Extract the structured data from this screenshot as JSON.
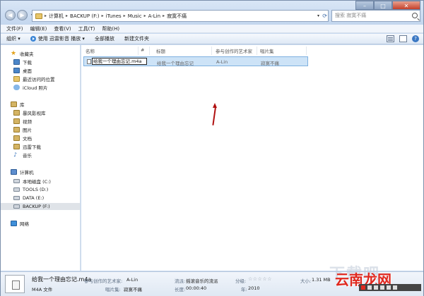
{
  "window": {
    "breadcrumbs": [
      "计算机",
      "BACKUP (F:)",
      "iTunes",
      "Music",
      "A-Lin",
      "寂寞不痛"
    ],
    "search_placeholder": "搜索 寂寞不痛",
    "controls": [
      "–",
      "□",
      "✕"
    ]
  },
  "menu": [
    "文件(F)",
    "编辑(E)",
    "查看(V)",
    "工具(T)",
    "帮助(H)"
  ],
  "toolbar": {
    "organize": "组织 ▾",
    "play_with": "使用 迅雷影音 播放 ▾",
    "play_all": "全部播放",
    "new_folder": "新建文件夹"
  },
  "nav": {
    "favorites_label": "收藏夹",
    "favorites": [
      "下载",
      "桌面",
      "最近访问的位置",
      "iCloud 照片"
    ],
    "library_label": "库",
    "library": [
      "暴风影视库",
      "视频",
      "图片",
      "文档",
      "迅雷下载",
      "音乐"
    ],
    "computer_label": "计算机",
    "computer": [
      "本地磁盘 (C:)",
      "TOOLS (D:)",
      "DATA (E:)",
      "BACKUP (F:)"
    ],
    "network_label": "网络"
  },
  "columns": [
    "名称",
    "#",
    "标题",
    "参与创作的艺术家",
    "唱片集"
  ],
  "file": {
    "rename_value": "给我一个理由忘记.m4a",
    "title": "给我一个理由忘记",
    "artist": "A-Lin",
    "album": "寂寞不痛"
  },
  "details": {
    "name": "给我一个理由忘记.m4a",
    "type": "M4A 文件",
    "artist_label": "参与创作的艺术家:",
    "artist": "A-Lin",
    "album_label": "唱片集:",
    "album": "寂寞不痛",
    "genre_label": "流派:",
    "genre": "摇滚音乐的流派",
    "length_label": "长度:",
    "length": "00:00:40",
    "rating_label": "分级:",
    "rating_stars": "☆☆☆☆☆",
    "year_label": "年:",
    "year": "2010",
    "size_label": "大小:",
    "size": "1.31 MB"
  },
  "watermark": {
    "top": "下载吧",
    "main": "云南龙网"
  }
}
